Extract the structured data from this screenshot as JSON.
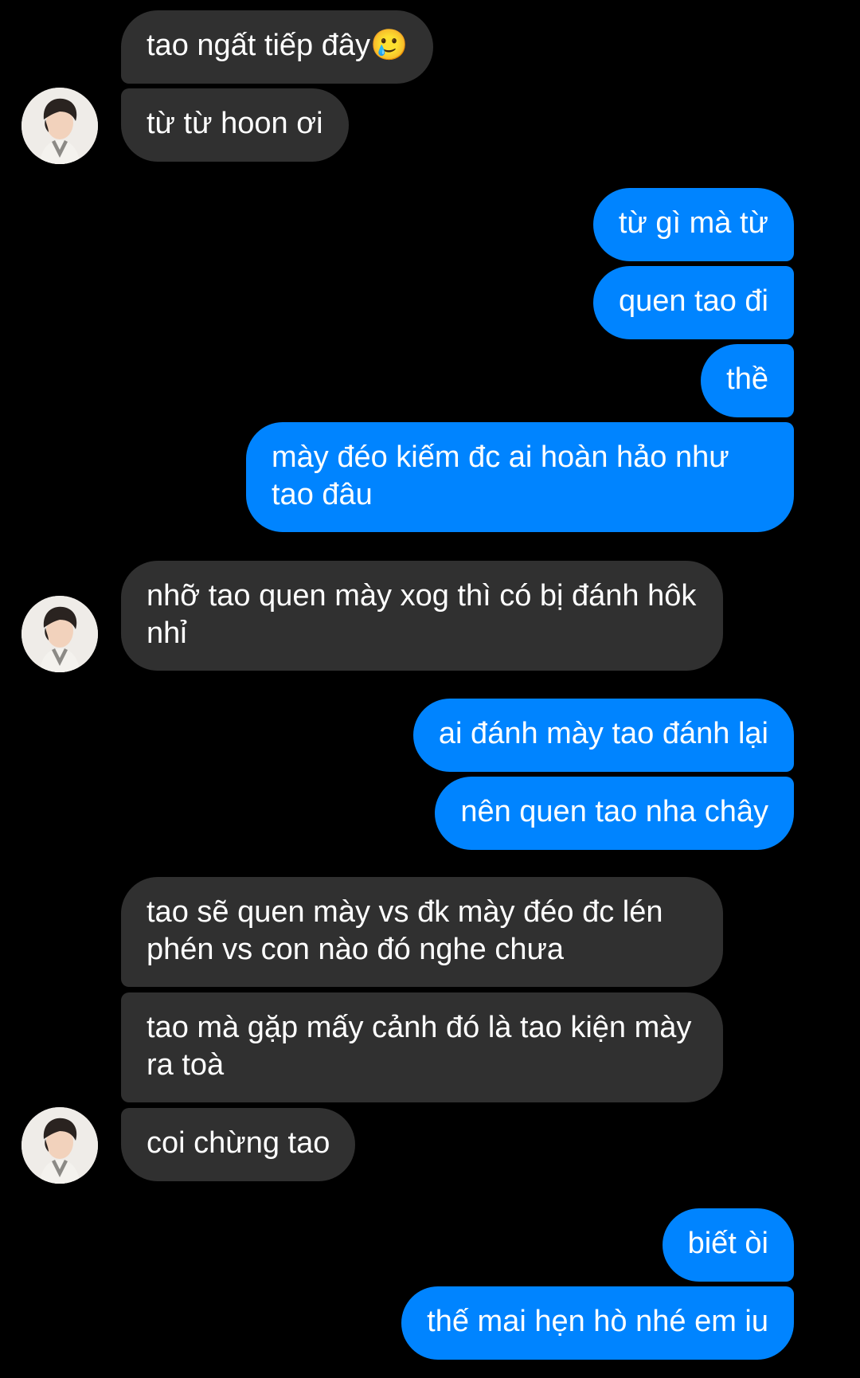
{
  "chat": {
    "messages": [
      {
        "sender": "them",
        "text": "tao ngất tiếp đây🥲"
      },
      {
        "sender": "them",
        "text": "từ từ hoon ơi"
      },
      {
        "sender": "me",
        "text": "từ gì mà từ"
      },
      {
        "sender": "me",
        "text": "quen tao đi"
      },
      {
        "sender": "me",
        "text": "thề"
      },
      {
        "sender": "me",
        "text": "mày đéo kiếm đc ai hoàn hảo như tao đâu"
      },
      {
        "sender": "them",
        "text": "nhỡ tao quen mày xog thì có bị đánh hôk nhỉ"
      },
      {
        "sender": "me",
        "text": "ai đánh mày tao đánh lại"
      },
      {
        "sender": "me",
        "text": "nên quen tao nha chây"
      },
      {
        "sender": "them",
        "text": "tao sẽ quen mày vs đk mày đéo đc lén phén vs con nào đó nghe chưa"
      },
      {
        "sender": "them",
        "text": "tao mà gặp mấy cảnh đó là tao kiện mày ra toà"
      },
      {
        "sender": "them",
        "text": "coi chừng tao"
      },
      {
        "sender": "me",
        "text": "biết òi"
      },
      {
        "sender": "me",
        "text": "thế mai hẹn hò nhé em iu"
      }
    ]
  },
  "colors": {
    "background": "#000000",
    "incoming_bubble": "#303030",
    "outgoing_bubble": "#0084ff",
    "text": "#ffffff"
  },
  "icons": {
    "avatar": "contact-avatar-photo"
  }
}
